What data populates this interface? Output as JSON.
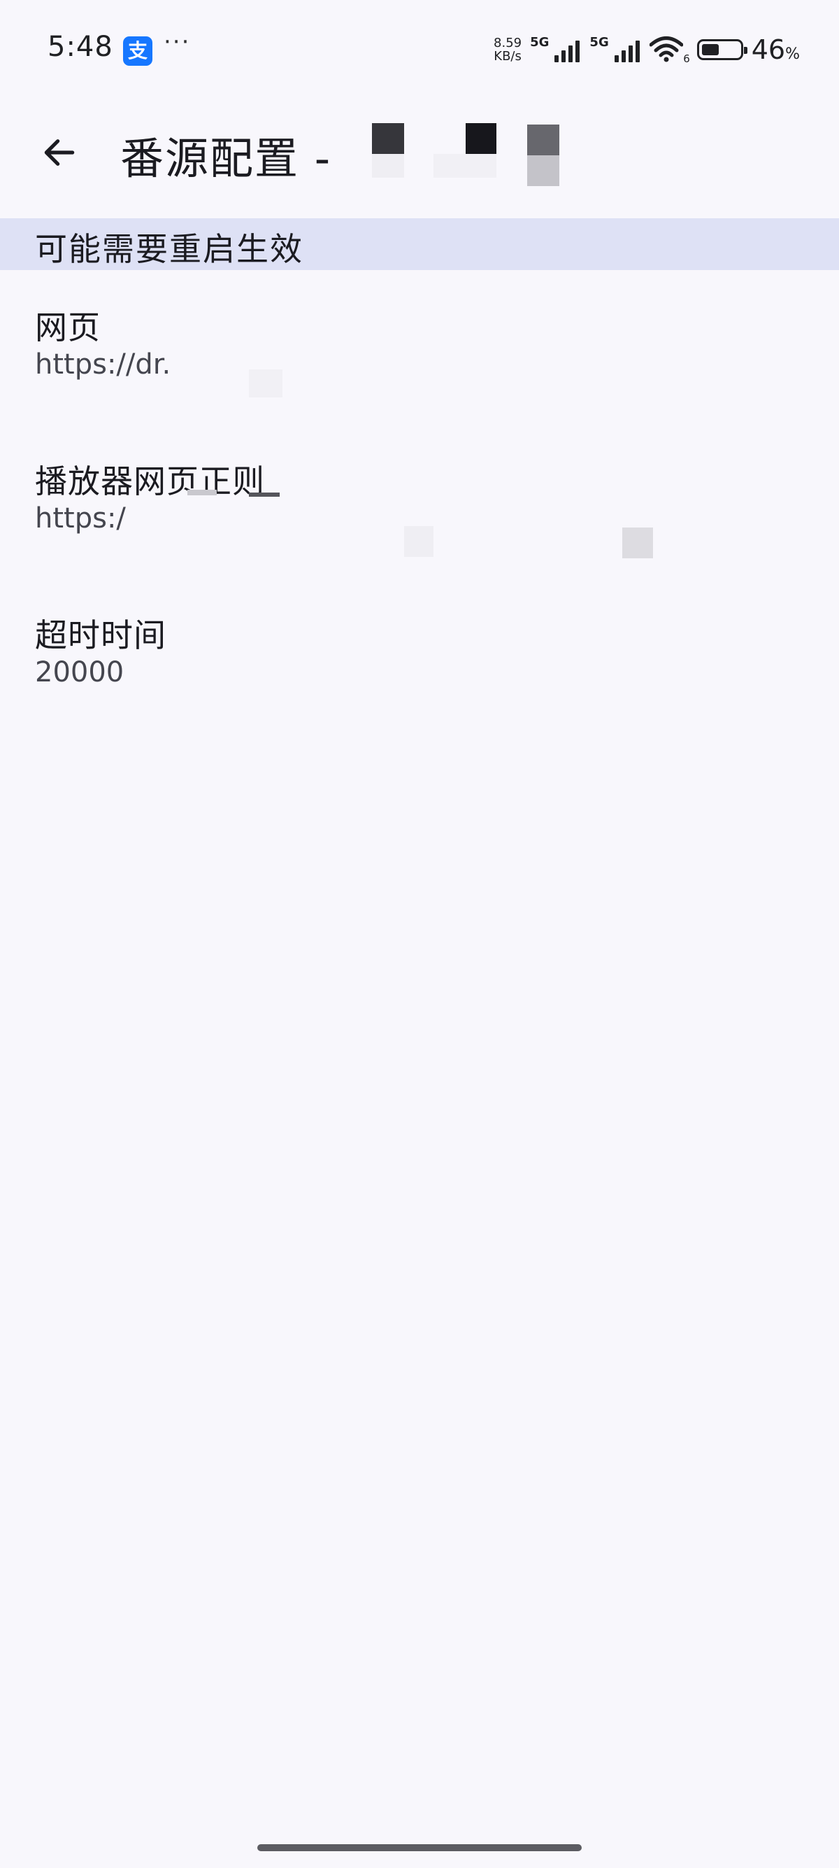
{
  "status_bar": {
    "time": "5:48",
    "alipay_glyph": "支",
    "more_dots": "···",
    "net_speed_value": "8.59",
    "net_speed_unit": "KB/s",
    "sim1_type": "5G",
    "sim2_type": "5G",
    "wifi_badge": "6",
    "battery_percent": "46",
    "battery_percent_sign": "%",
    "battery_level": 0.46
  },
  "app_bar": {
    "back_icon": "arrow-left-icon",
    "title": "番源配置 -"
  },
  "banner": {
    "text": "可能需要重启生效"
  },
  "settings": [
    {
      "title": "网页",
      "value": "https://dr."
    },
    {
      "title": "播放器网页正则",
      "value": "https:/"
    },
    {
      "title": "超时时间",
      "value": "20000"
    }
  ],
  "colors": {
    "background": "#f8f7fc",
    "banner": "#dee1f5",
    "primary_text": "#1b1b21",
    "secondary_text": "#45464f",
    "alipay_blue": "#1677ff"
  }
}
